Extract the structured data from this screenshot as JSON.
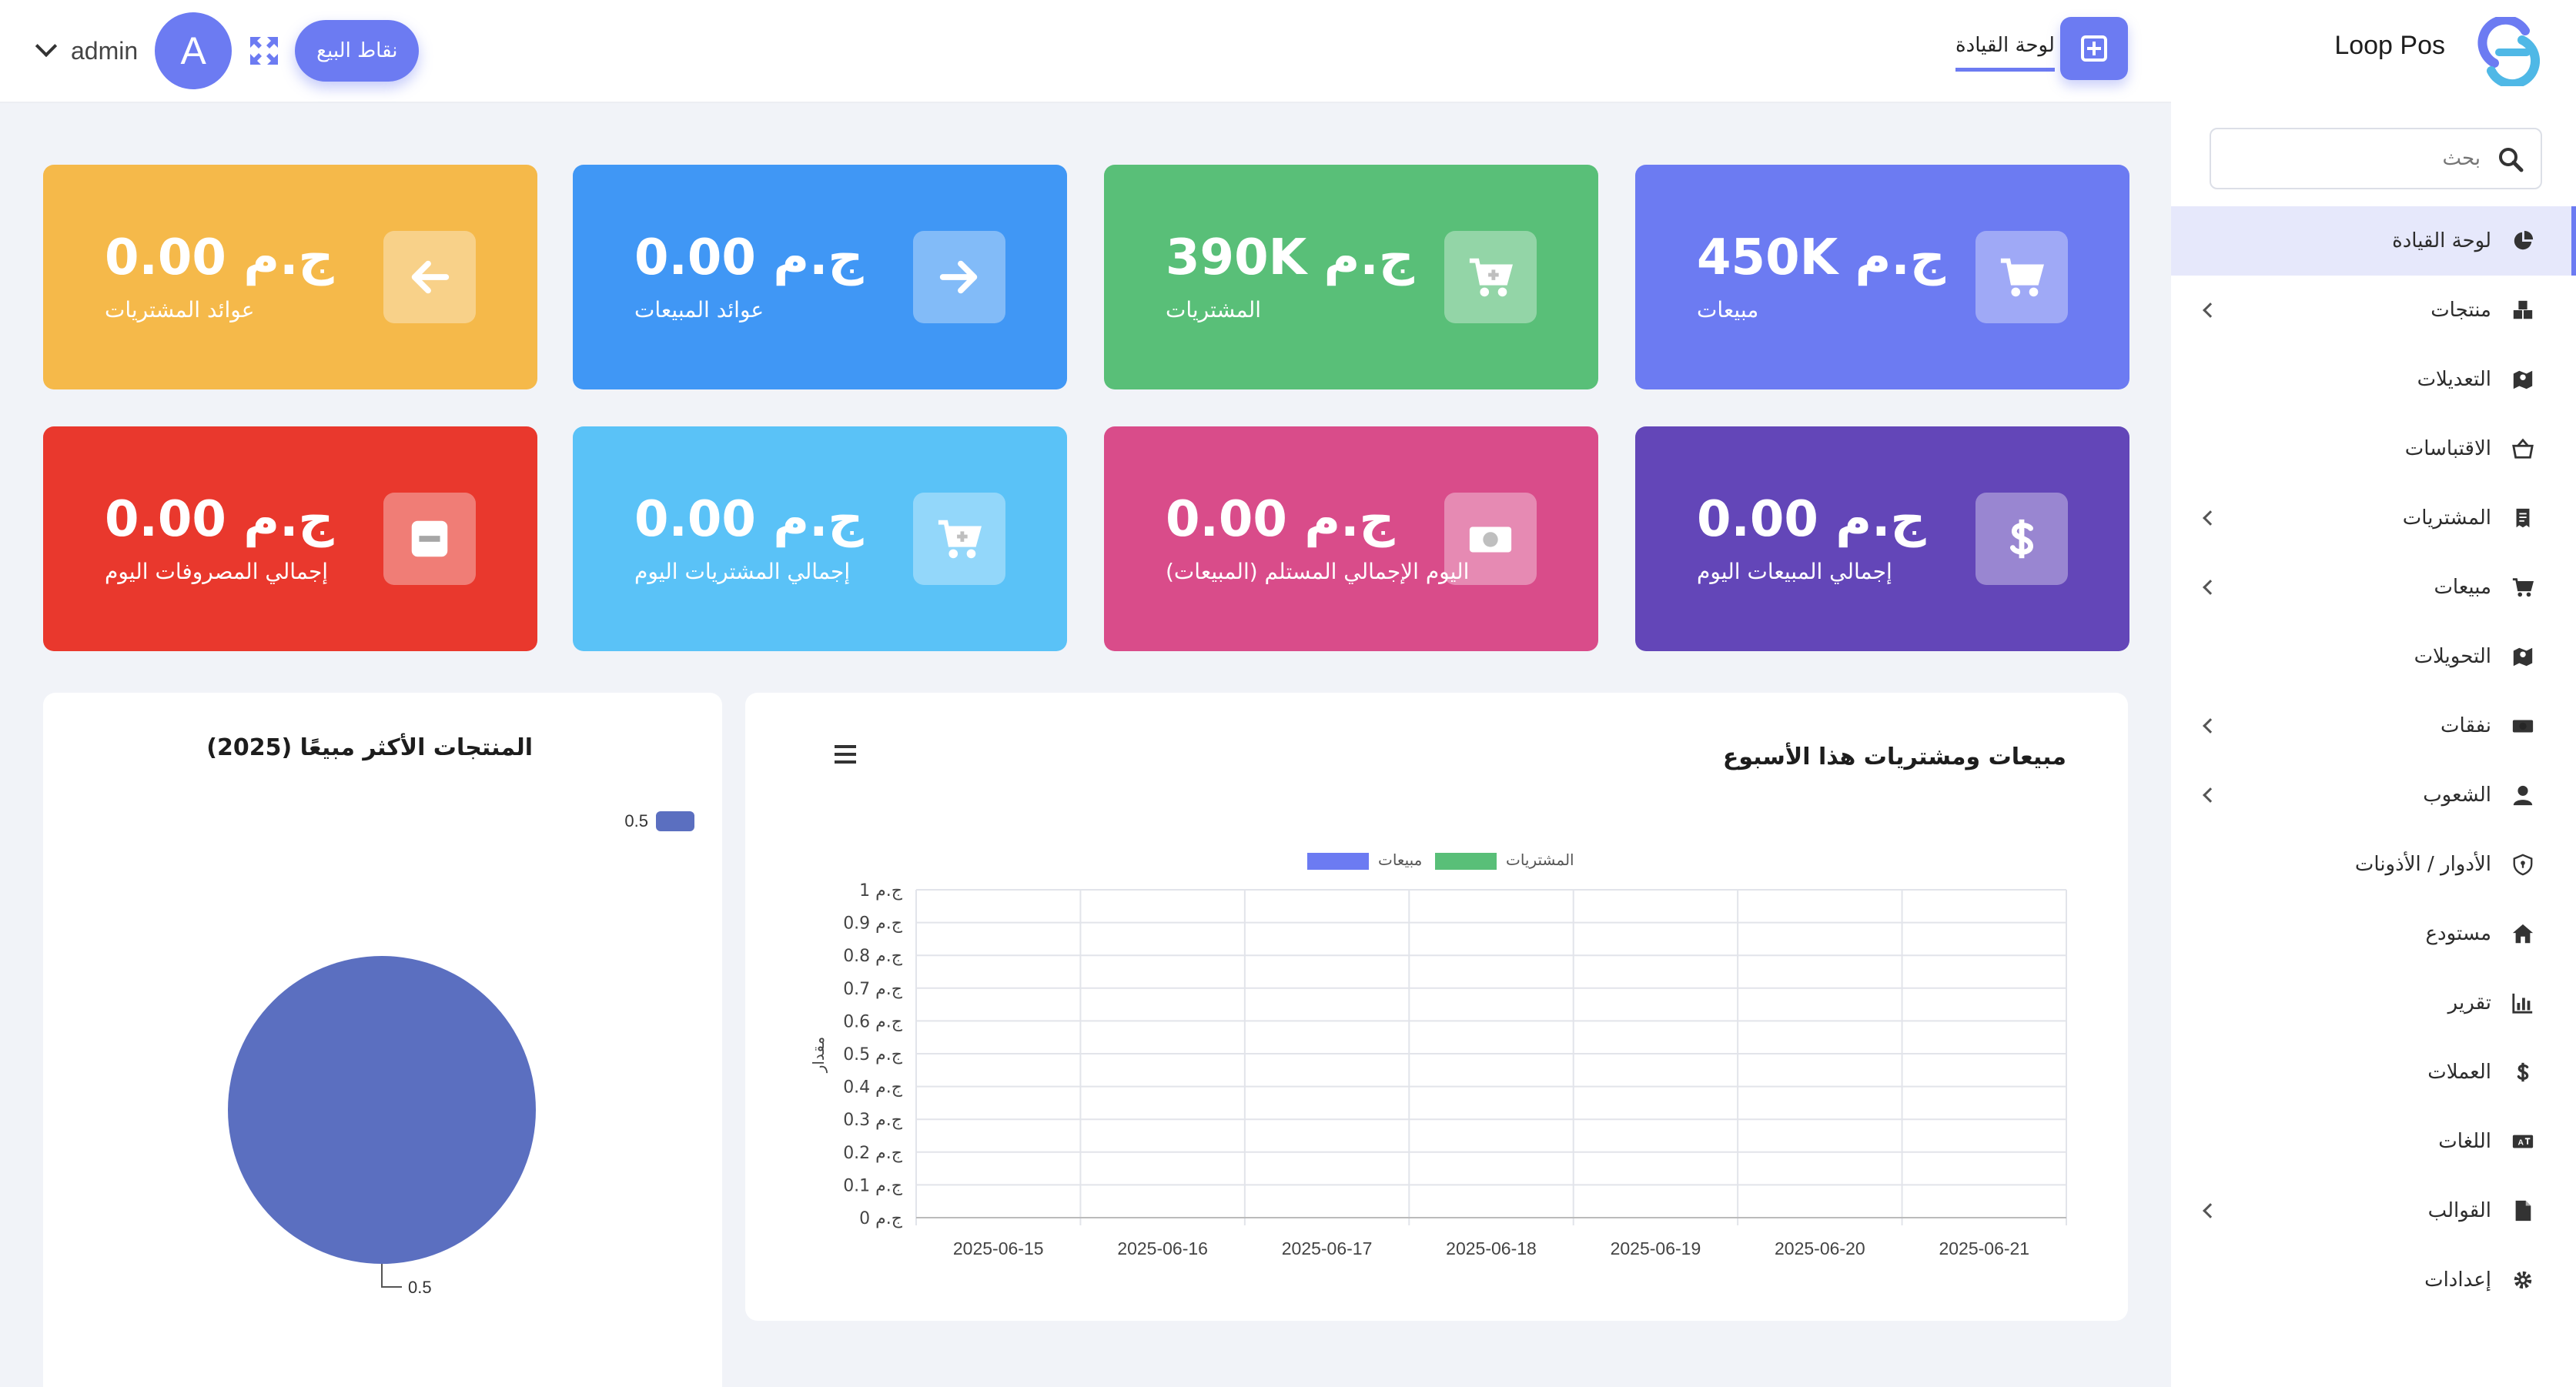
{
  "header": {
    "brand": "Loop Pos",
    "tab_dashboard": "لوحة القيادة",
    "pos_button": "نقاط البيع",
    "user_initial": "A",
    "user_name": "admin"
  },
  "sidebar": {
    "search_placeholder": "بحث",
    "items": [
      {
        "label": "لوحة القيادة",
        "icon": "pie-chart-icon",
        "active": true,
        "chevron": false
      },
      {
        "label": "منتجات",
        "icon": "boxes-icon",
        "chevron": true
      },
      {
        "label": "التعديلات",
        "icon": "map-icon",
        "chevron": false
      },
      {
        "label": "الاقتباسات",
        "icon": "basket-icon",
        "chevron": false
      },
      {
        "label": "المشتريات",
        "icon": "receipt-icon",
        "chevron": true
      },
      {
        "label": "مبيعات",
        "icon": "cart-icon",
        "chevron": true
      },
      {
        "label": "التحويلات",
        "icon": "map-icon",
        "chevron": false
      },
      {
        "label": "نفقات",
        "icon": "money-icon",
        "chevron": true
      },
      {
        "label": "الشعوب",
        "icon": "user-icon",
        "chevron": true
      },
      {
        "label": "الأدوار / الأذونات",
        "icon": "shield-icon",
        "chevron": false
      },
      {
        "label": "مستودع",
        "icon": "home-icon",
        "chevron": false
      },
      {
        "label": "تقرير",
        "icon": "bar-chart-icon",
        "chevron": false
      },
      {
        "label": "العملات",
        "icon": "dollar-icon",
        "chevron": false
      },
      {
        "label": "اللغات",
        "icon": "language-icon",
        "chevron": false
      },
      {
        "label": "القوالب",
        "icon": "file-icon",
        "chevron": true
      },
      {
        "label": "إعدادات",
        "icon": "gear-icon",
        "chevron": false
      }
    ]
  },
  "cards": [
    {
      "value": "ج.م 450K",
      "label": "مبيعات",
      "color": "#6c7bf2",
      "icon": "cart-icon"
    },
    {
      "value": "ج.م 390K",
      "label": "المشتريات",
      "color": "#59bf78",
      "icon": "cart-plus-icon"
    },
    {
      "value": "ج.م 0.00",
      "label": "عوائد المبيعات",
      "color": "#4097f5",
      "icon": "arrow-right-icon"
    },
    {
      "value": "ج.م 0.00",
      "label": "عوائد المشتريات",
      "color": "#f5b94a",
      "icon": "arrow-left-icon"
    },
    {
      "value": "ج.م 0.00",
      "label": "إجمالي المبيعات اليوم",
      "color": "#6346b8",
      "icon": "dollar-icon"
    },
    {
      "value": "ج.م 0.00",
      "label": "اليوم الإجمالي المستلم (المبيعات)",
      "color": "#d94c8a",
      "icon": "money-icon"
    },
    {
      "value": "ج.م 0.00",
      "label": "إجمالي المشتريات اليوم",
      "color": "#5ac2f7",
      "icon": "cart-plus-icon"
    },
    {
      "value": "ج.م 0.00",
      "label": "إجمالي المصروفات اليوم",
      "color": "#e9382d",
      "icon": "minus-icon"
    }
  ],
  "weekly_chart": {
    "title": "مبيعات ومشتريات هذا الأسبوع"
  },
  "pie_chart": {
    "title": "المنتجات الأكثر مبيعًا (2025)"
  },
  "chart_data": [
    {
      "type": "bar",
      "title": "مبيعات ومشتريات هذا الأسبوع",
      "ylabel": "مقدار",
      "categories": [
        "2025-06-15",
        "2025-06-16",
        "2025-06-17",
        "2025-06-18",
        "2025-06-19",
        "2025-06-20",
        "2025-06-21"
      ],
      "series": [
        {
          "name": "مبيعات",
          "color": "#6c7bf2",
          "values": [
            0,
            0,
            0,
            0,
            0,
            0,
            0
          ]
        },
        {
          "name": "المشتريات",
          "color": "#59bf78",
          "values": [
            0,
            0,
            0,
            0,
            0,
            0,
            0
          ]
        }
      ],
      "ylim": [
        0,
        1
      ],
      "yticks": [
        "0 ج.م",
        "0.1 ج.م",
        "0.2 ج.م",
        "0.3 ج.م",
        "0.4 ج.م",
        "0.5 ج.م",
        "0.6 ج.م",
        "0.7 ج.م",
        "0.8 ج.م",
        "0.9 ج.م",
        "1 ج.م"
      ],
      "grid": true,
      "legend": "top-center"
    },
    {
      "type": "pie",
      "title": "المنتجات الأكثر مبيعًا (2025)",
      "slices": [
        {
          "label": "0.5",
          "value": 0.5,
          "color": "#5b6fc0"
        }
      ],
      "legend": "top-right"
    }
  ]
}
